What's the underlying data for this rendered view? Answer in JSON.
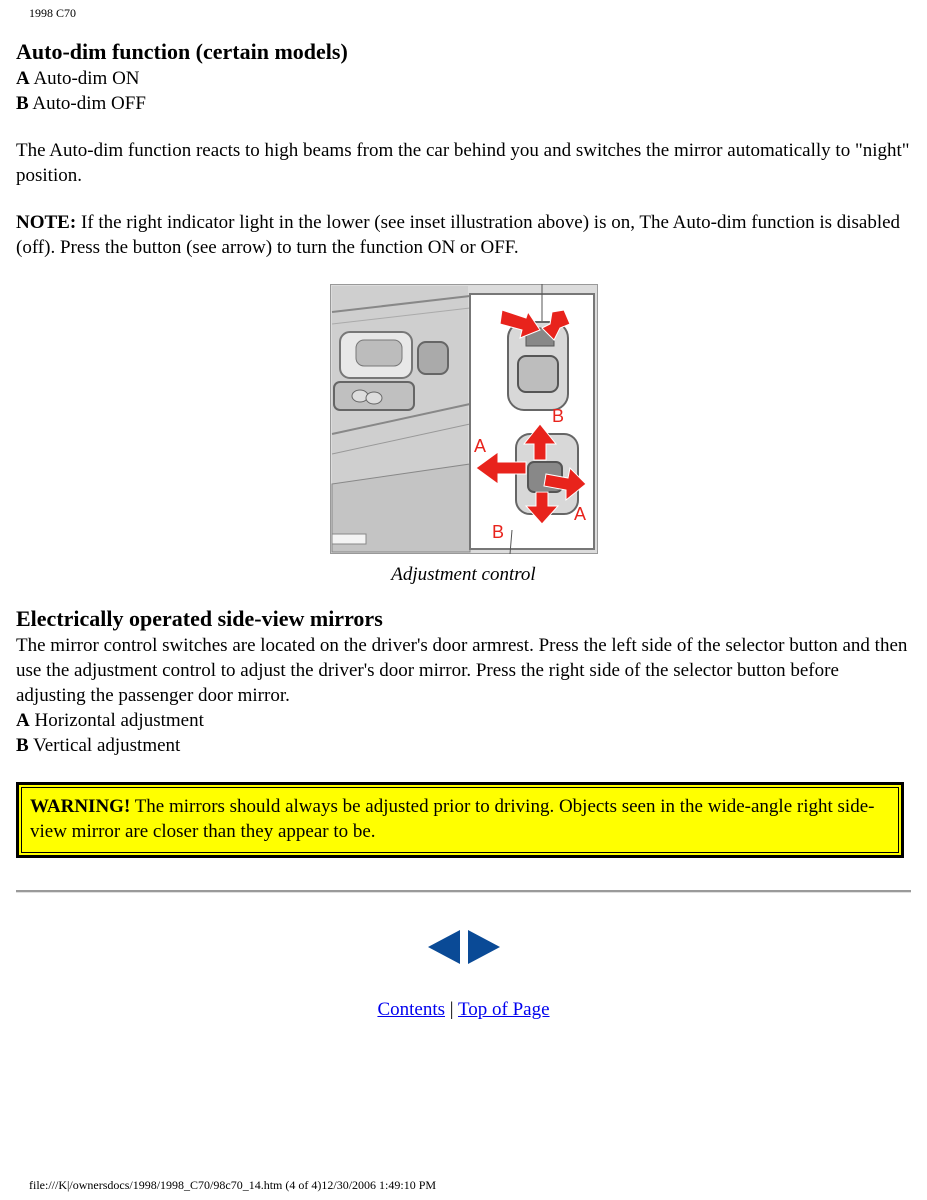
{
  "header": {
    "doc_label": "1998 C70"
  },
  "autodim": {
    "title": "Auto-dim function (certain models)",
    "items": [
      {
        "key": "A",
        "text": "Auto-dim ON"
      },
      {
        "key": "B",
        "text": "Auto-dim OFF"
      }
    ],
    "paragraph": "The Auto-dim function reacts to high beams from the car behind you and switches the mirror automatically to \"night\" position.",
    "note_label": "NOTE:",
    "note_text": " If the right indicator light in the lower (see inset illustration above) is on, The Auto-dim function is disabled (off). Press the button (see arrow) to turn the function ON or OFF."
  },
  "figure": {
    "caption": "Adjustment control",
    "labels": {
      "a": "A",
      "b": "B"
    },
    "colors": {
      "arrow_red": "#e8231c",
      "panel_gray": "#c8c8c8"
    }
  },
  "mirrors": {
    "title": "Electrically operated side-view mirrors",
    "paragraph": "The mirror control switches are located on the driver's door armrest. Press the left side of the selector button and then use the adjustment control to adjust the driver's door mirror. Press the right side of the selector button before adjusting the passenger door mirror.",
    "items": [
      {
        "key": "A",
        "text": "Horizontal adjustment"
      },
      {
        "key": "B",
        "text": "Vertical adjustment"
      }
    ]
  },
  "warning": {
    "label": "WARNING!",
    "text": " The mirrors should always be adjusted prior to driving. Objects seen in the wide-angle right side-view mirror are closer than they appear to be.",
    "color": "#ffff00"
  },
  "nav": {
    "prev_icon": "arrow-left-icon",
    "next_icon": "arrow-right-icon",
    "contents_label": "Contents",
    "separator": " | ",
    "top_label": "Top of Page",
    "color": "#0a4a96"
  },
  "footer": {
    "text": "file:///K|/ownersdocs/1998/1998_C70/98c70_14.htm (4 of 4)12/30/2006 1:49:10 PM"
  }
}
